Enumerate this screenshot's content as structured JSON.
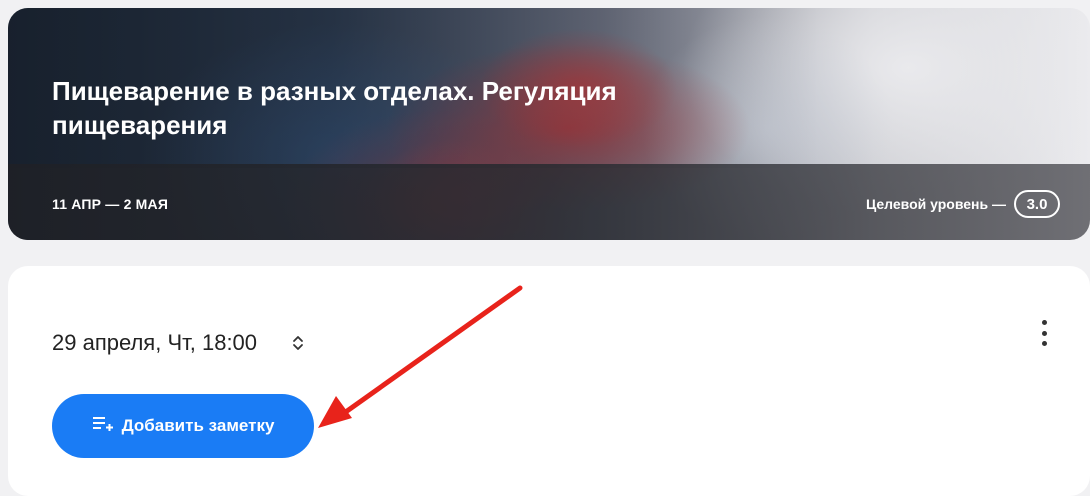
{
  "banner": {
    "title": "Пищеварение в разных отделах. Регуляция пищеварения",
    "dates": "11 АПР — 2 МАЯ",
    "level_label": "Целевой уровень —",
    "level_value": "3.0"
  },
  "lesson": {
    "datetime": "29 апреля, Чт, 18:00",
    "add_note_label": "Добавить заметку",
    "icons": {
      "sort": "unfold-chevrons-icon",
      "more": "more-vertical-icon",
      "note": "playlist-add-icon"
    }
  },
  "annotation": {
    "arrow_color": "#e8231b"
  },
  "colors": {
    "accent": "#1a7cf5",
    "card_bg": "#ffffff",
    "page_bg": "#f1f1f3"
  }
}
